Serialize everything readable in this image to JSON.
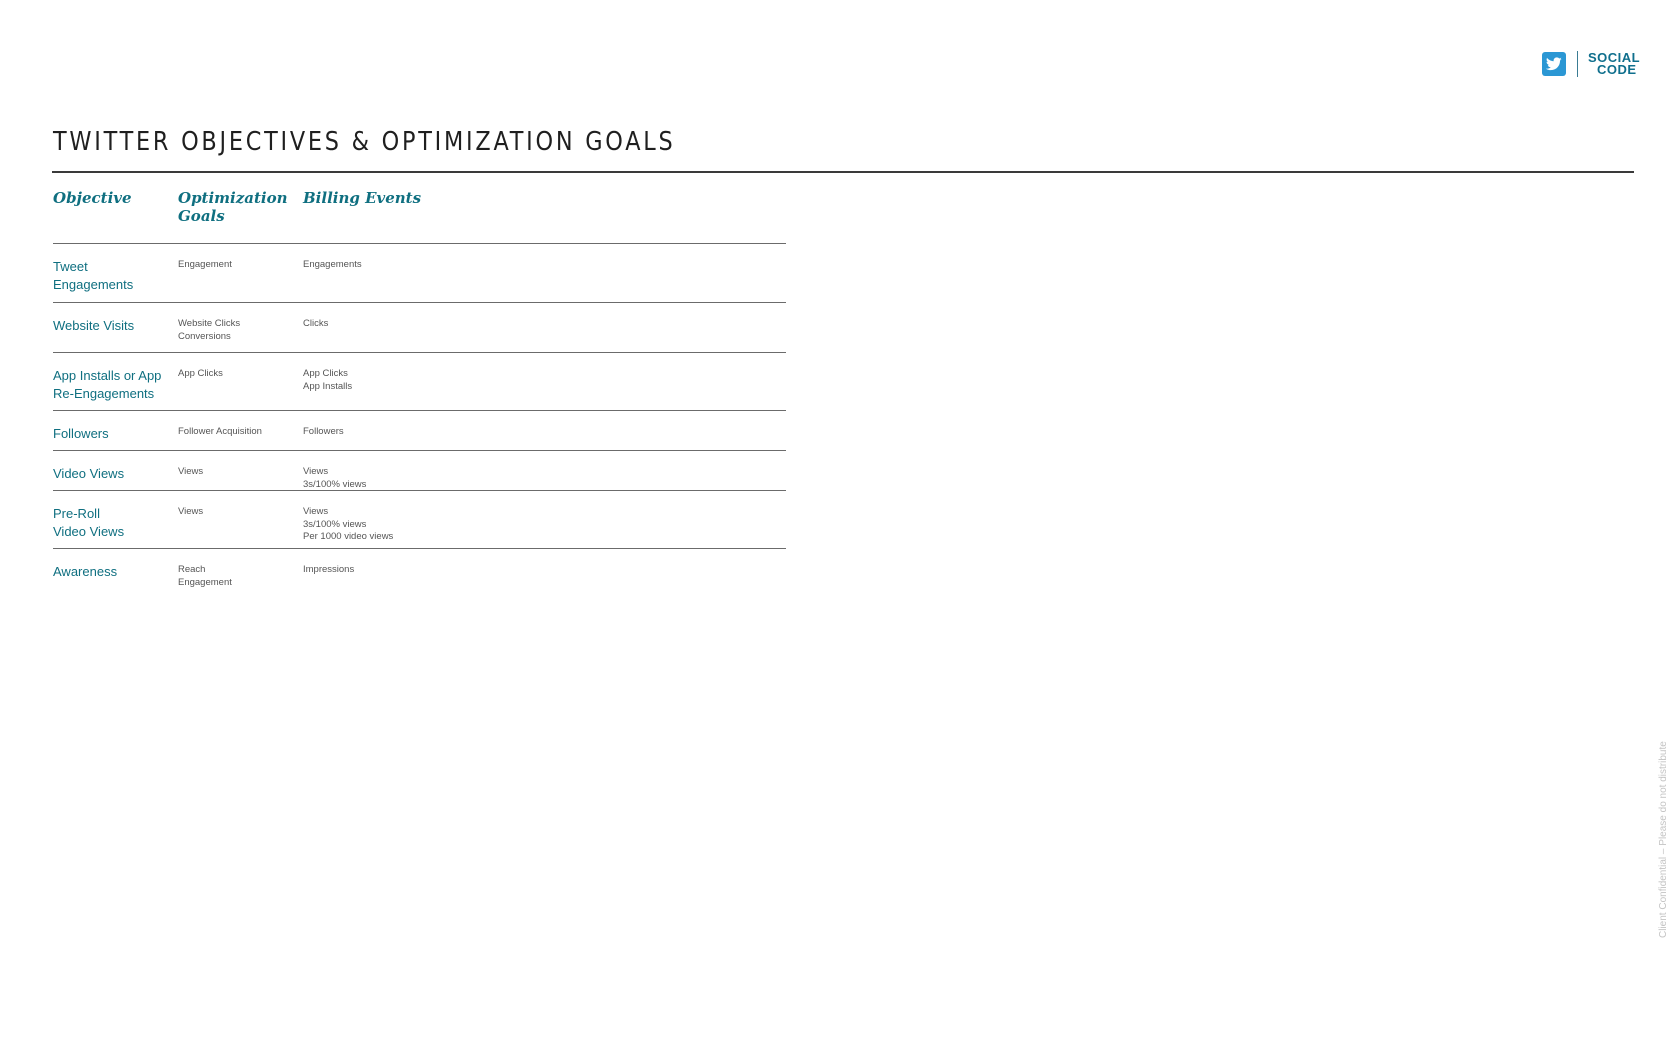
{
  "header": {
    "title": "TWITTER OBJECTIVES & OPTIMIZATION GOALS",
    "brand_line1": "SOCIAL",
    "brand_line2": "CODE"
  },
  "table": {
    "headers": {
      "objective": "Objective",
      "optimization": "Optimization Goals",
      "billing": "Billing Events"
    },
    "rows": [
      {
        "objective": [
          "Tweet",
          "Engagements"
        ],
        "optimization": [
          "Engagement"
        ],
        "billing": [
          "Engagements"
        ]
      },
      {
        "objective": [
          "Website Visits"
        ],
        "optimization": [
          "Website Clicks",
          "Conversions"
        ],
        "billing": [
          "Clicks"
        ]
      },
      {
        "objective": [
          "App Installs or App",
          "Re-Engagements"
        ],
        "optimization": [
          "App Clicks"
        ],
        "billing": [
          "App Clicks",
          "App Installs"
        ]
      },
      {
        "objective": [
          "Followers"
        ],
        "optimization": [
          "Follower Acquisition"
        ],
        "billing": [
          "Followers"
        ]
      },
      {
        "objective": [
          "Video Views"
        ],
        "optimization": [
          "Views"
        ],
        "billing": [
          "Views",
          "3s/100% views"
        ]
      },
      {
        "objective": [
          "Pre-Roll",
          "Video Views"
        ],
        "optimization": [
          "Views"
        ],
        "billing": [
          "Views",
          "3s/100% views",
          "Per 1000 video views"
        ]
      },
      {
        "objective": [
          "Awareness"
        ],
        "optimization": [
          "Reach",
          "Engagement"
        ],
        "billing": [
          "Impressions"
        ]
      }
    ]
  },
  "footer": {
    "confidential": "Client Confidential – Please do not distribute"
  },
  "colors": {
    "accent": "#0f6f80",
    "twitter_blue": "#2b97d4",
    "rule": "#3a3a3a"
  },
  "icons": {
    "twitter": "twitter-bird-icon",
    "brand": "socialcode-logo"
  }
}
